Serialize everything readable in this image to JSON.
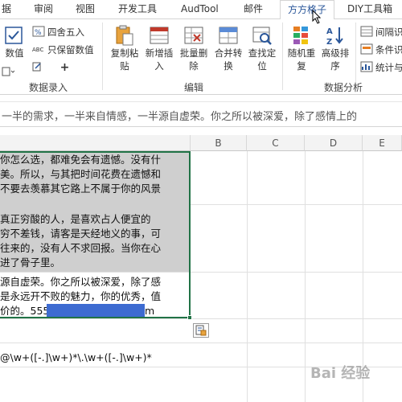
{
  "tabs": [
    {
      "label": "据"
    },
    {
      "label": "审阅"
    },
    {
      "label": "视图"
    },
    {
      "label": "开发工具"
    },
    {
      "label": "AudTool"
    },
    {
      "label": "邮件"
    },
    {
      "label": "方方格子",
      "active": true
    },
    {
      "label": "DIY工具箱"
    }
  ],
  "ribbon": {
    "groups": {
      "data_entry": "数据录入",
      "edit": "编辑",
      "data_analysis": "数据分析"
    },
    "data_entry": {
      "number_btn": "数值",
      "round_btn": "四舍五入",
      "keep_value_btn": "只保留数值",
      "plus_glyph": "+"
    },
    "edit": {
      "copy_paste": [
        "复制粘",
        "贴"
      ],
      "insert": [
        "新增插",
        "入"
      ],
      "batch_delete": [
        "批量删",
        "除"
      ],
      "merge_convert": [
        "合并转",
        "换"
      ],
      "find_locate": [
        "查找定",
        "位"
      ]
    },
    "data_analysis": {
      "random_repeat": [
        "随机重",
        "复"
      ],
      "advanced_sort": [
        "高级排",
        "序"
      ],
      "interval": "间隔识",
      "condition": "条件识",
      "stats": "统计与"
    }
  },
  "formula_bar": {
    "text": "一半的需求，一半来自情感，一半源自虚荣。你之所以被深爱，除了感情上的"
  },
  "columns": [
    "B",
    "C",
    "D",
    "E"
  ],
  "cell_lines": [
    "你怎么选，都难免会有遗憾。没有什",
    "美。所以，与其把时间花费在遗憾和",
    "不要去羡慕其它路上不属于你的风景",
    "",
    "真正穷酸的人，是喜欢占人便宜的",
    "穷不差钱，请客是天经地义的事，可",
    "往来的，没有人不求回报。当你在心",
    "进了骨子里。",
    "源自虚荣。你之所以被深爱，除了感",
    "是永远开不败的魅力，你的优秀，值",
    "价的。555"
  ],
  "cell_tail": "m",
  "regex_text": "@\\w+([-.]\\w+)*\\.\\w+([-.]\\w+)*",
  "watermark": "Bai 经验",
  "colors": {
    "accent": "#217346",
    "tab_active": "#2b579a",
    "redact": "#3d6bd1",
    "selection": "#cfcfcf"
  }
}
